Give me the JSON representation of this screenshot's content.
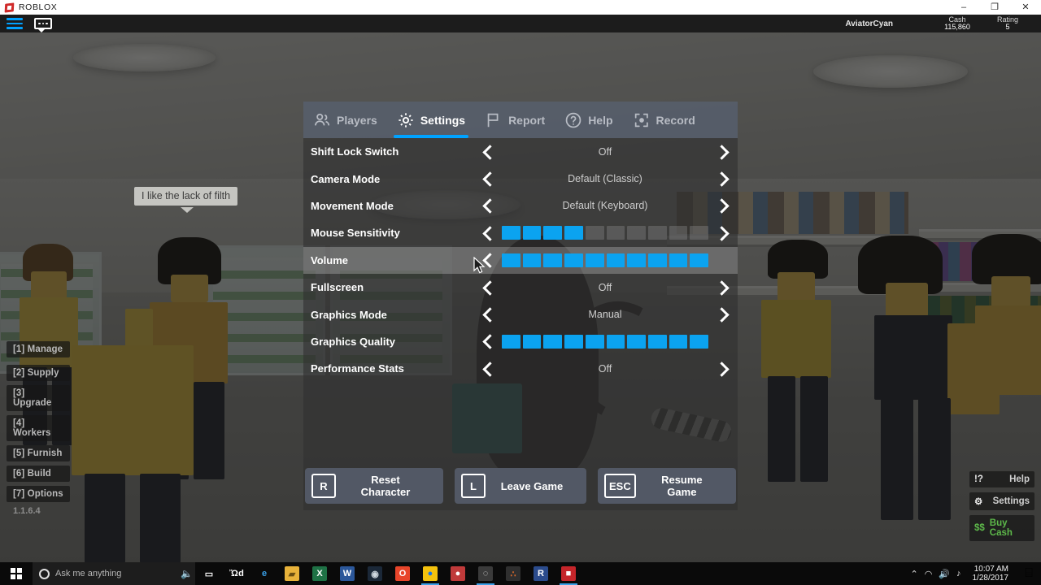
{
  "window": {
    "title": "ROBLOX",
    "controls": {
      "minimize": "–",
      "maximize": "❐",
      "close": "✕"
    }
  },
  "topbar": {
    "player_name": "AviatorCyan",
    "stats": [
      {
        "label": "Cash",
        "value": "115,860"
      },
      {
        "label": "Rating",
        "value": "5"
      }
    ]
  },
  "game_hud": {
    "chat_message": "I like the lack of filth",
    "left_menu": [
      {
        "label": "[1] Manage"
      },
      {
        "label": "[2] Supply"
      },
      {
        "label": "[3] Upgrade"
      },
      {
        "label": "[4] Workers"
      },
      {
        "label": "[5] Furnish"
      },
      {
        "label": "[6] Build"
      },
      {
        "label": "[7] Options"
      }
    ],
    "version": "1.1.6.4",
    "right_menu": [
      {
        "key": "!?",
        "label": "Help"
      },
      {
        "key": "⚙",
        "label": "Settings"
      },
      {
        "key": "$$",
        "label": "Buy Cash"
      }
    ]
  },
  "pause_menu": {
    "tabs": [
      {
        "label": "Players",
        "icon": "people-icon",
        "active": false
      },
      {
        "label": "Settings",
        "icon": "gear-icon",
        "active": true
      },
      {
        "label": "Report",
        "icon": "flag-icon",
        "active": false
      },
      {
        "label": "Help",
        "icon": "question-circle-icon",
        "active": false
      },
      {
        "label": "Record",
        "icon": "record-frame-icon",
        "active": false
      }
    ],
    "settings_rows": [
      {
        "label": "Shift Lock Switch",
        "type": "value",
        "value": "Off",
        "highlight": false
      },
      {
        "label": "Camera Mode",
        "type": "value",
        "value": "Default (Classic)",
        "highlight": false
      },
      {
        "label": "Movement Mode",
        "type": "value",
        "value": "Default (Keyboard)",
        "highlight": false
      },
      {
        "label": "Mouse Sensitivity",
        "type": "slider",
        "filled": 4,
        "total": 10,
        "highlight": false
      },
      {
        "label": "Volume",
        "type": "slider",
        "filled": 10,
        "total": 10,
        "highlight": true
      },
      {
        "label": "Fullscreen",
        "type": "value",
        "value": "Off",
        "highlight": false
      },
      {
        "label": "Graphics Mode",
        "type": "value",
        "value": "Manual",
        "highlight": false
      },
      {
        "label": "Graphics Quality",
        "type": "slider",
        "filled": 10,
        "total": 10,
        "highlight": false
      },
      {
        "label": "Performance Stats",
        "type": "value",
        "value": "Off",
        "highlight": false
      }
    ],
    "actions": [
      {
        "key": "R",
        "label": "Reset Character"
      },
      {
        "key": "L",
        "label": "Leave Game"
      },
      {
        "key": "ESC",
        "label": "Resume Game"
      }
    ]
  },
  "taskbar": {
    "search_placeholder": "Ask me anything",
    "clock": {
      "time": "10:07 AM",
      "date": "1/28/2017"
    },
    "apps": [
      {
        "name": "task-view-icon",
        "glyph": "▭",
        "color": "transparent",
        "text": "#ffffff",
        "running": false
      },
      {
        "name": "store-icon",
        "glyph": "Ὤd",
        "color": "transparent",
        "text": "#ffffff",
        "running": false
      },
      {
        "name": "edge-icon",
        "glyph": "e",
        "color": "transparent",
        "text": "#3aa0e8",
        "running": false
      },
      {
        "name": "file-explorer-icon",
        "glyph": "▰",
        "color": "#e8b23a",
        "text": "#6b4f12",
        "running": false
      },
      {
        "name": "excel-icon",
        "glyph": "X",
        "color": "#1e7145",
        "text": "#ffffff",
        "running": false
      },
      {
        "name": "word-icon",
        "glyph": "W",
        "color": "#2b579a",
        "text": "#ffffff",
        "running": false
      },
      {
        "name": "steam-icon",
        "glyph": "◉",
        "color": "#1b2838",
        "text": "#cfd8e0",
        "running": false
      },
      {
        "name": "opera-icon",
        "glyph": "O",
        "color": "#e8452a",
        "text": "#ffffff",
        "running": false
      },
      {
        "name": "chrome-icon",
        "glyph": "●",
        "color": "#f4c20d",
        "text": "#1a73e8",
        "running": true
      },
      {
        "name": "creature-icon",
        "glyph": "●",
        "color": "#c03a3a",
        "text": "#ffffff",
        "running": false
      },
      {
        "name": "obs-icon",
        "glyph": "◌",
        "color": "#3a3a3a",
        "text": "#e8e8e8",
        "running": true
      },
      {
        "name": "krita-icon",
        "glyph": "∴",
        "color": "#2f2f2f",
        "text": "#e06a2a",
        "running": false
      },
      {
        "name": "roblox-studio-icon",
        "glyph": "R",
        "color": "#2b4b8c",
        "text": "#ffffff",
        "running": false
      },
      {
        "name": "roblox-player-icon",
        "glyph": "■",
        "color": "#c5252a",
        "text": "#ffffff",
        "running": true
      }
    ],
    "tray": [
      {
        "name": "show-hidden-icons",
        "glyph": "⌃"
      },
      {
        "name": "wifi-icon",
        "glyph": "◠"
      },
      {
        "name": "volume-icon",
        "glyph": "🔊"
      },
      {
        "name": "network-icon",
        "glyph": "♪"
      }
    ],
    "action_center": "⌸"
  },
  "colors": {
    "accent_blue": "#00a2ff",
    "slider_fill": "#0ba3f0",
    "tabbar_bg": "#565e6b",
    "cash_green": "#5db84a"
  }
}
